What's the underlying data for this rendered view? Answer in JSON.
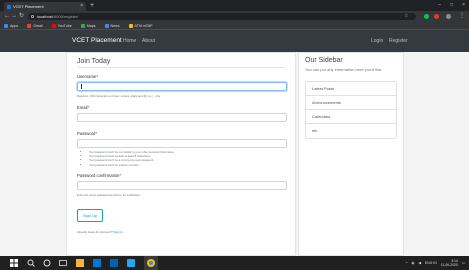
{
  "browser": {
    "tab_title": "VCET Placement",
    "new_tab": "+",
    "url_host": "localhost",
    "url_path": ":8000/register/",
    "bookmarks": [
      {
        "label": "Apps",
        "color": "#4285f4"
      },
      {
        "label": "Gmail",
        "color": "#ea4335"
      },
      {
        "label": "YouTube",
        "color": "#ff0000"
      },
      {
        "label": "Maps",
        "color": "#34a853"
      },
      {
        "label": "News",
        "color": "#4285f4"
      },
      {
        "label": "ATM mTAP",
        "color": "#fbbc05"
      }
    ]
  },
  "site_nav": {
    "brand": "VCET Placement",
    "links": [
      "Home",
      "About"
    ],
    "right_links": [
      "Login",
      "Register"
    ]
  },
  "form": {
    "legend": "Join Today",
    "username_label": "Username*",
    "username_help": "Required. 150 characters or fewer. Letters, digits and @/./+/-/_ only.",
    "email_label": "Email*",
    "password_label": "Password*",
    "password_rules": [
      "Your password can't be too similar to your other personal information.",
      "Your password must contain at least 8 characters.",
      "Your password can't be a commonly used password.",
      "Your password can't be entirely numeric."
    ],
    "confirm_label": "Password confirmation*",
    "confirm_help": "Enter the same password as before, for verification.",
    "submit_label": "Sign Up",
    "have_account": "Already Have An Account?",
    "signin_link": "Sign In"
  },
  "sidebar": {
    "title": "Our Sidebar",
    "text": "You can put any information here you'd like.",
    "items": [
      "Latest Posts",
      "Announcements",
      "Calendars",
      "etc"
    ]
  },
  "taskbar": {
    "time": "3:14",
    "date": "11-06-2020",
    "lang": "ENG IN"
  }
}
